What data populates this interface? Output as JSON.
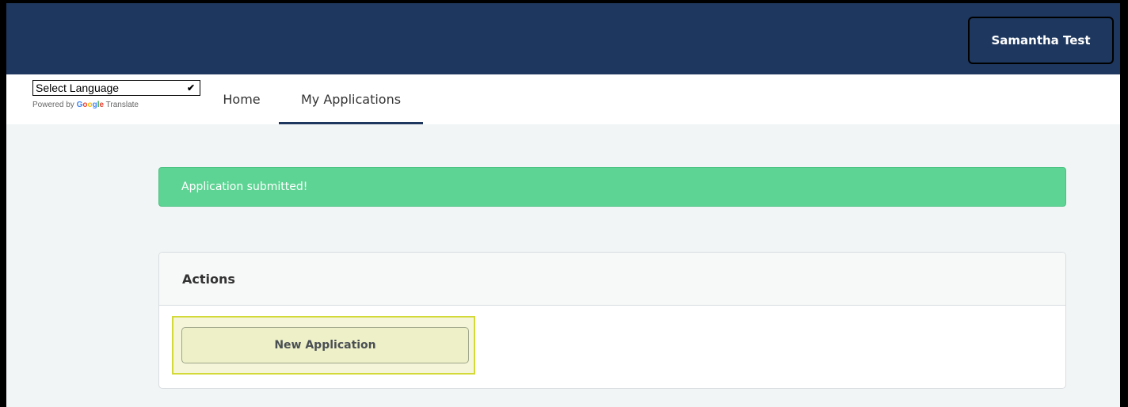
{
  "header": {
    "user_name": "Samantha Test"
  },
  "translate": {
    "select_label": "Select Language",
    "powered_by": "Powered by",
    "google_letters": [
      "G",
      "o",
      "o",
      "g",
      "l",
      "e"
    ],
    "translate_word": "Translate"
  },
  "nav": {
    "home": "Home",
    "my_applications": "My Applications",
    "active": "my_applications"
  },
  "alert": {
    "message": "Application submitted!"
  },
  "actions": {
    "title": "Actions",
    "new_application": "New Application"
  },
  "colors": {
    "topbar": "#1e375e",
    "success": "#5dd493",
    "highlight_border": "#d4d93a"
  }
}
